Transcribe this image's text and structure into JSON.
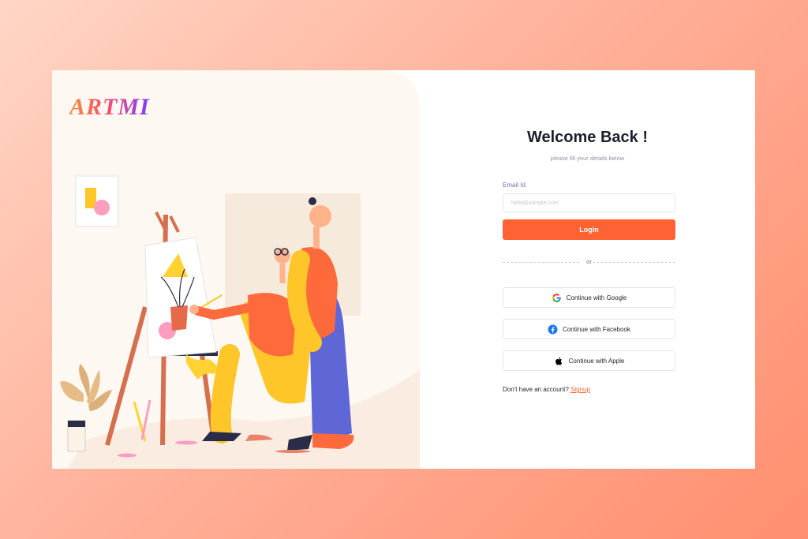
{
  "brand": {
    "logo_text": "ARTMI"
  },
  "form": {
    "title": "Welcome Back !",
    "subtitle": "please fill your details below",
    "email_label": "Email Id",
    "email_placeholder": "hello@xample.com",
    "email_value": "",
    "login_label": "Login",
    "divider_text": "or",
    "google_label": "Continue with Google",
    "facebook_label": "Continue with Facebook",
    "apple_label": "Continue with Apple",
    "signup_prompt": "Don't have an account?",
    "signup_link": "Signup"
  },
  "icons": {
    "google": "google-icon",
    "facebook": "facebook-icon",
    "apple": "apple-icon"
  },
  "colors": {
    "accent": "#ff6333",
    "label": "#7b67b8",
    "art_background": "#fdf8f1"
  }
}
